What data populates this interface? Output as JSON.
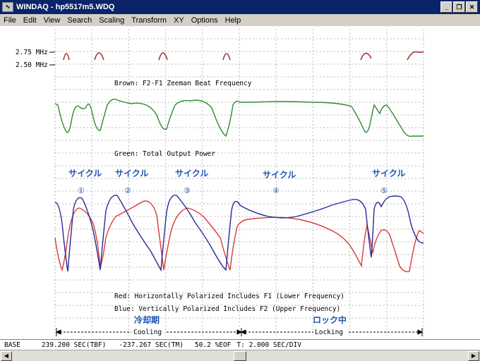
{
  "window": {
    "title": "WINDAQ - hp5517m5.WDQ",
    "app_icon": "wave-icon"
  },
  "window_controls": {
    "minimize": "_",
    "restore": "❐",
    "close": "✕"
  },
  "menu": [
    "File",
    "Edit",
    "View",
    "Search",
    "Scaling",
    "Transform",
    "XY",
    "Options",
    "Help"
  ],
  "plot": {
    "y_labels": [
      "2.75 MHz",
      "2.50 MHz"
    ],
    "brown_label": "Brown: F2-F1 Zeeman Beat Frequency",
    "green_label": "Green: Total Output Power",
    "red_label": "Red: Horizontally Polarized  Includes F1 (Lower Frequency)",
    "blue_label": "Blue: Vertically Polarized  Includes F2 (Upper Frequency)",
    "cycle_label": "サイクル",
    "cycle_numbers": [
      "①",
      "②",
      "③",
      "④",
      "⑤"
    ],
    "cooling_jp": "冷却期",
    "cooling_en": "Cooling",
    "locking_jp": "ロック中",
    "locking_en": "Locking",
    "colors": {
      "brown": "#a52a2a",
      "green": "#2e8b2e",
      "red": "#d93a3a",
      "blue": "#2a2a9a",
      "grid": "#b8b8b8"
    }
  },
  "status": {
    "base": "BASE",
    "tbf": "239.200 SEC(TBF)",
    "tm": "-237.267 SEC(TM)",
    "eof": "50.2 %EOF",
    "t": "T: 2.000 SEC/DIV"
  },
  "scrollbar": {
    "position_fraction": 0.5
  }
}
